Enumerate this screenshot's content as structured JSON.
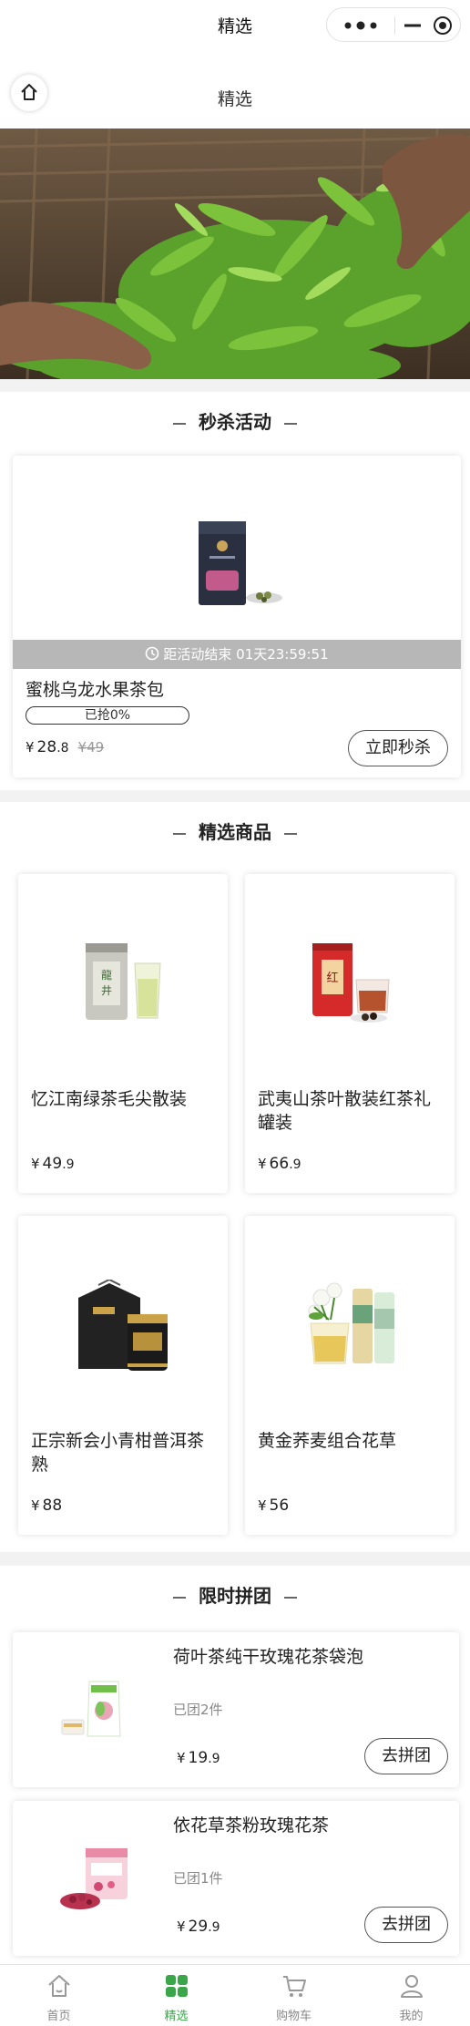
{
  "window": {
    "title": "精选"
  },
  "capsule": {
    "more_icon": "more-dots-icon",
    "minimize_icon": "minus-icon",
    "close_icon": "target-circle-icon"
  },
  "navbar": {
    "title": "精选",
    "home_icon": "home-icon"
  },
  "banner": {
    "image": "hands picking fresh green tea leaves"
  },
  "flash_sale": {
    "title": "秒杀活动",
    "item": {
      "countdown_prefix": "距活动结束",
      "countdown": "01天23:59:51",
      "name": "蜜桃乌龙水果茶包",
      "progress_label": "已抢0%",
      "progress": 0,
      "price_symbol": "¥",
      "price_int": "28",
      "price_dec": ".8",
      "original_price": "¥49",
      "button": "立即秒杀"
    }
  },
  "featured": {
    "title": "精选商品",
    "items": [
      {
        "name": "忆江南绿茶毛尖散装",
        "symbol": "¥",
        "price_int": "49",
        "price_dec": ".9"
      },
      {
        "name": "武夷山茶叶散装红茶礼罐装",
        "symbol": "¥",
        "price_int": "66",
        "price_dec": ".9"
      },
      {
        "name": "正宗新会小青柑普洱茶熟",
        "symbol": "¥",
        "price_int": "88",
        "price_dec": ""
      },
      {
        "name": "黄金荞麦组合花草",
        "symbol": "¥",
        "price_int": "56",
        "price_dec": ""
      }
    ]
  },
  "group_buy": {
    "title": "限时拼团",
    "items": [
      {
        "name": "荷叶茶纯干玫瑰花茶袋泡",
        "joined": "已团2件",
        "symbol": "¥",
        "price_int": "19",
        "price_dec": ".9",
        "button": "去拼团"
      },
      {
        "name": "依花草茶粉玫瑰花茶",
        "joined": "已团1件",
        "symbol": "¥",
        "price_int": "29",
        "price_dec": ".9",
        "button": "去拼团"
      }
    ]
  },
  "tabbar": {
    "items": [
      {
        "label": "首页",
        "icon": "home-icon"
      },
      {
        "label": "精选",
        "icon": "grid-icon",
        "active": true
      },
      {
        "label": "购物车",
        "icon": "cart-icon"
      },
      {
        "label": "我的",
        "icon": "user-icon"
      }
    ]
  },
  "colors": {
    "accent": "#3aa64a",
    "countdown_bar": "#b7b7b7",
    "background": "#f2f2f2"
  }
}
